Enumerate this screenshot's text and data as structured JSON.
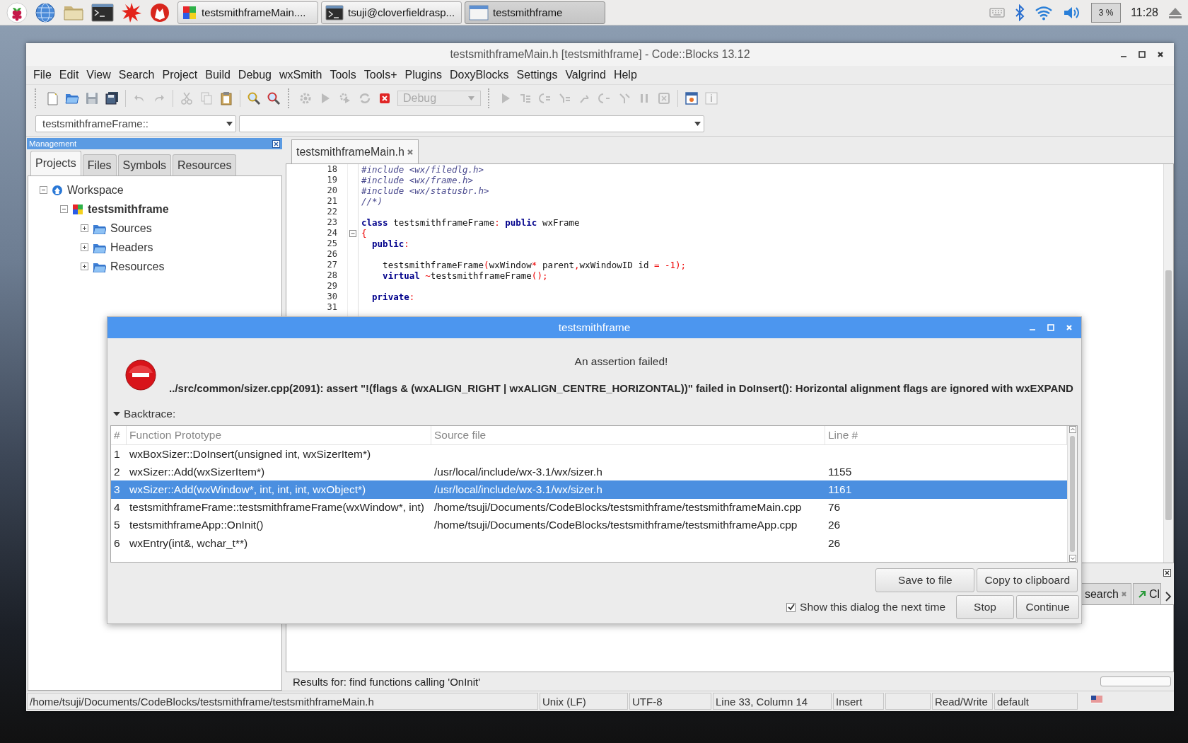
{
  "taskbar": {
    "tasks": [
      {
        "label": "testsmithframeMain....",
        "kind": "codeblocks",
        "selected": false
      },
      {
        "label": "tsuji@cloverfieldrasp...",
        "kind": "terminal",
        "selected": false
      },
      {
        "label": "testsmithframe",
        "kind": "window",
        "selected": true
      }
    ],
    "cpu": "3 %",
    "clock": "11:28"
  },
  "window": {
    "title": "testsmithframeMain.h [testsmithframe] - Code::Blocks 13.12"
  },
  "menu": [
    "File",
    "Edit",
    "View",
    "Search",
    "Project",
    "Build",
    "Debug",
    "wxSmith",
    "Tools",
    "Tools+",
    "Plugins",
    "DoxyBlocks",
    "Settings",
    "Valgrind",
    "Help"
  ],
  "toolbar": {
    "build_target": "Debug",
    "code_scope": "testsmithframeFrame::"
  },
  "management": {
    "title": "Management",
    "tabs": [
      {
        "label": "Projects",
        "selected": true
      },
      {
        "label": "Files",
        "selected": false
      },
      {
        "label": "Symbols",
        "selected": false
      },
      {
        "label": "Resources",
        "selected": false
      }
    ],
    "tree": [
      {
        "label": "Workspace",
        "kind": "workspace",
        "expanded": true,
        "children": [
          {
            "label": "testsmithframe",
            "kind": "project",
            "expanded": true,
            "children": [
              {
                "label": "Sources",
                "kind": "folder",
                "expanded": false
              },
              {
                "label": "Headers",
                "kind": "folder",
                "expanded": false
              },
              {
                "label": "Resources",
                "kind": "folder",
                "expanded": false
              }
            ]
          }
        ]
      }
    ]
  },
  "editor": {
    "tabs": [
      {
        "label": "testsmithframeMain.h",
        "selected": true
      }
    ],
    "lines": [
      {
        "number": "18",
        "fold": false,
        "tokens": [
          {
            "text": "#include <wx/filedlg.h>",
            "kind": "comment"
          }
        ]
      },
      {
        "number": "19",
        "fold": false,
        "tokens": [
          {
            "text": "#include <wx/frame.h>",
            "kind": "comment"
          }
        ]
      },
      {
        "number": "20",
        "fold": false,
        "tokens": [
          {
            "text": "#include <wx/statusbr.h>",
            "kind": "comment"
          }
        ]
      },
      {
        "number": "21",
        "fold": false,
        "tokens": [
          {
            "text": "//*)",
            "kind": "comment"
          }
        ]
      },
      {
        "number": "22",
        "fold": false
      },
      {
        "number": "23",
        "fold": false,
        "tokens": [
          {
            "text": "class",
            "kind": "keyword"
          },
          {
            "text": " testsmithframeFrame",
            "kind": "plain"
          },
          {
            "text": ":",
            "kind": "operator"
          },
          {
            "text": " public",
            "kind": "keyword"
          },
          {
            "text": " wxFrame",
            "kind": "plain"
          }
        ]
      },
      {
        "number": "24",
        "fold": true,
        "tokens": [
          {
            "text": "{",
            "kind": "operator"
          }
        ]
      },
      {
        "number": "25",
        "fold": false,
        "tokens": [
          {
            "text": "  public",
            "kind": "keyword"
          },
          {
            "text": ":",
            "kind": "operator"
          }
        ]
      },
      {
        "number": "26",
        "fold": false
      },
      {
        "number": "27",
        "fold": false,
        "tokens": [
          {
            "text": "    testsmithframeFrame",
            "kind": "plain"
          },
          {
            "text": "(",
            "kind": "operator"
          },
          {
            "text": "wxWindow",
            "kind": "plain"
          },
          {
            "text": "*",
            "kind": "operator"
          },
          {
            "text": " parent",
            "kind": "plain"
          },
          {
            "text": ",",
            "kind": "operator"
          },
          {
            "text": "wxWindowID id ",
            "kind": "plain"
          },
          {
            "text": "= -1);",
            "kind": "operator"
          }
        ]
      },
      {
        "number": "28",
        "fold": false,
        "tokens": [
          {
            "text": "    virtual",
            "kind": "keyword"
          },
          {
            "text": " ~",
            "kind": "operator"
          },
          {
            "text": "testsmithframeFrame",
            "kind": "plain"
          },
          {
            "text": "();",
            "kind": "operator"
          }
        ]
      },
      {
        "number": "29",
        "fold": false
      },
      {
        "number": "30",
        "fold": false,
        "tokens": [
          {
            "text": "  private",
            "kind": "keyword"
          },
          {
            "text": ":",
            "kind": "operator"
          }
        ]
      },
      {
        "number": "31",
        "fold": false
      }
    ]
  },
  "logs": {
    "tabs": [
      {
        "label": "search",
        "kind": "closable"
      },
      {
        "label": "Cl",
        "kind": "icon"
      }
    ],
    "results": "Results for: find functions calling 'OnInit'"
  },
  "status_bar": [
    "/home/tsuji/Documents/CodeBlocks/testsmithframe/testsmithframeMain.h",
    "Unix (LF)",
    "UTF-8",
    "Line 33, Column 14",
    "Insert",
    "Read/Write",
    "default"
  ],
  "dialog": {
    "title": "testsmithframe",
    "heading": "An assertion failed!",
    "message": "../src/common/sizer.cpp(2091): assert \"!(flags & (wxALIGN_RIGHT | wxALIGN_CENTRE_HORIZONTAL))\" failed in DoInsert(): Horizontal alignment flags are ignored with wxEXPAND",
    "backtrace": {
      "label": "Backtrace:",
      "expanded": true,
      "columns": [
        "#",
        "Function Prototype",
        "Source file",
        "Line #"
      ],
      "rows": [
        {
          "number": "1",
          "function": "wxBoxSizer::DoInsert(unsigned int, wxSizerItem*)",
          "selected": false
        },
        {
          "number": "2",
          "function": "wxSizer::Add(wxSizerItem*)",
          "source": "/usr/local/include/wx-3.1/wx/sizer.h",
          "line": "1155",
          "selected": false
        },
        {
          "number": "3",
          "function": "wxSizer::Add(wxWindow*, int, int, int, wxObject*)",
          "source": "/usr/local/include/wx-3.1/wx/sizer.h",
          "line": "1161",
          "selected": true
        },
        {
          "number": "4",
          "function": "testsmithframeFrame::testsmithframeFrame(wxWindow*, int)",
          "source": "/home/tsuji/Documents/CodeBlocks/testsmithframe/testsmithframeMain.cpp",
          "line": "76",
          "selected": false
        },
        {
          "number": "5",
          "function": "testsmithframeApp::OnInit()",
          "source": "/home/tsuji/Documents/CodeBlocks/testsmithframe/testsmithframeApp.cpp",
          "line": "26",
          "selected": false
        },
        {
          "number": "6",
          "function": "wxEntry(int&, wchar_t**)",
          "line": "26",
          "selected": false
        }
      ]
    },
    "buttons": [
      "Save to file",
      "Copy to clipboard"
    ],
    "show_again": {
      "label": "Show this dialog the next time",
      "checked": true
    },
    "actions": [
      "Stop",
      "Continue"
    ]
  }
}
